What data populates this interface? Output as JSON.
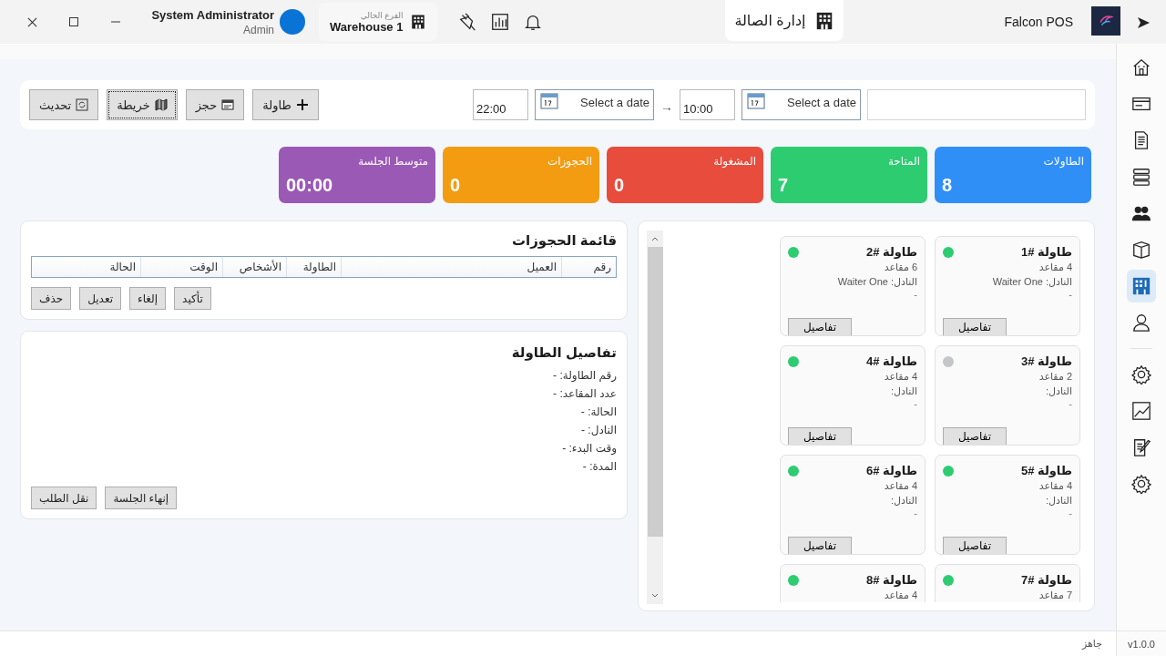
{
  "user": {
    "name": "System Administrator",
    "role": "Admin"
  },
  "branch": {
    "label": "الفرع الحالي",
    "name": "Warehouse 1"
  },
  "page_tab": {
    "title": "إدارة الصالة"
  },
  "app": {
    "name": "Falcon POS"
  },
  "filters": {
    "from_date": {
      "placeholder": "Select a date"
    },
    "from_time": "10:00",
    "range_arrow": "→",
    "to_date": {
      "placeholder": "Select a date"
    },
    "to_time": "22:00"
  },
  "toolbar_buttons": [
    {
      "kind": "add",
      "label": "طاولة",
      "focused": false
    },
    {
      "kind": "reserve",
      "label": "حجز",
      "focused": false
    },
    {
      "kind": "map",
      "label": "خريطة",
      "focused": true
    },
    {
      "kind": "refresh",
      "label": "تحديث",
      "focused": false
    }
  ],
  "stats": [
    {
      "label": "الطاولات",
      "value": "8",
      "color": "#2f8ff7"
    },
    {
      "label": "المتاحة",
      "value": "7",
      "color": "#2ecc71"
    },
    {
      "label": "المشغولة",
      "value": "0",
      "color": "#e74c3c"
    },
    {
      "label": "الحجوزات",
      "value": "0",
      "color": "#f39c12"
    },
    {
      "label": "متوسط الجلسة",
      "value": "00:00",
      "color": "#9b59b6"
    }
  ],
  "tables": [
    {
      "title": "طاولة #1",
      "seats": "4 مقاعد",
      "waiter": "النادل: Waiter One",
      "note": "-",
      "button": "تفاصيل",
      "color": "#2ecc71"
    },
    {
      "title": "طاولة #2",
      "seats": "6 مقاعد",
      "waiter": "النادل: Waiter One",
      "note": "-",
      "button": "تفاصيل",
      "color": "#2ecc71"
    },
    {
      "title": "طاولة #3",
      "seats": "2 مقاعد",
      "waiter": "النادل:",
      "note": "-",
      "button": "تفاصيل",
      "color": "#c4c6c8"
    },
    {
      "title": "طاولة #4",
      "seats": "4 مقاعد",
      "waiter": "النادل:",
      "note": "-",
      "button": "تفاصيل",
      "color": "#2ecc71"
    },
    {
      "title": "طاولة #5",
      "seats": "4 مقاعد",
      "waiter": "النادل:",
      "note": "-",
      "button": "تفاصيل",
      "color": "#2ecc71"
    },
    {
      "title": "طاولة #6",
      "seats": "4 مقاعد",
      "waiter": "النادل:",
      "note": "-",
      "button": "تفاصيل",
      "color": "#2ecc71"
    },
    {
      "title": "طاولة #7",
      "seats": "7 مقاعد",
      "color": "#2ecc71"
    },
    {
      "title": "طاولة #8",
      "seats": "4 مقاعد",
      "color": "#2ecc71"
    }
  ],
  "reservations": {
    "title": "قائمة الحجوزات",
    "columns": [
      "رقم",
      "العميل",
      "الطاولة",
      "الأشخاص",
      "الوقت",
      "الحالة"
    ],
    "buttons": [
      "تأكيد",
      "إلغاء",
      "تعديل",
      "حذف"
    ]
  },
  "table_details": {
    "title": "تفاصيل الطاولة",
    "fields": [
      "رقم الطاولة: -",
      "عدد المقاعد: -",
      "الحالة: -",
      "النادل: -",
      "وقت البدء: -",
      "المدة: -"
    ],
    "buttons": [
      "إنهاء الجلسة",
      "نقل الطلب"
    ]
  },
  "sidebar": {
    "groups": [
      [
        {
          "kind": "home",
          "selected": false
        },
        {
          "kind": "card",
          "selected": false
        },
        {
          "kind": "document",
          "selected": false
        },
        {
          "kind": "stack",
          "selected": false
        },
        {
          "kind": "people",
          "selected": false
        },
        {
          "kind": "box",
          "selected": false
        },
        {
          "kind": "floor",
          "selected": true
        },
        {
          "kind": "person",
          "selected": false
        }
      ],
      [
        {
          "kind": "gear",
          "selected": false
        },
        {
          "kind": "chart",
          "selected": false
        },
        {
          "kind": "edit",
          "selected": false
        },
        {
          "kind": "gear",
          "selected": false
        }
      ]
    ],
    "version": "v1.0.0"
  },
  "status_bar": {
    "text": "جاهز"
  }
}
